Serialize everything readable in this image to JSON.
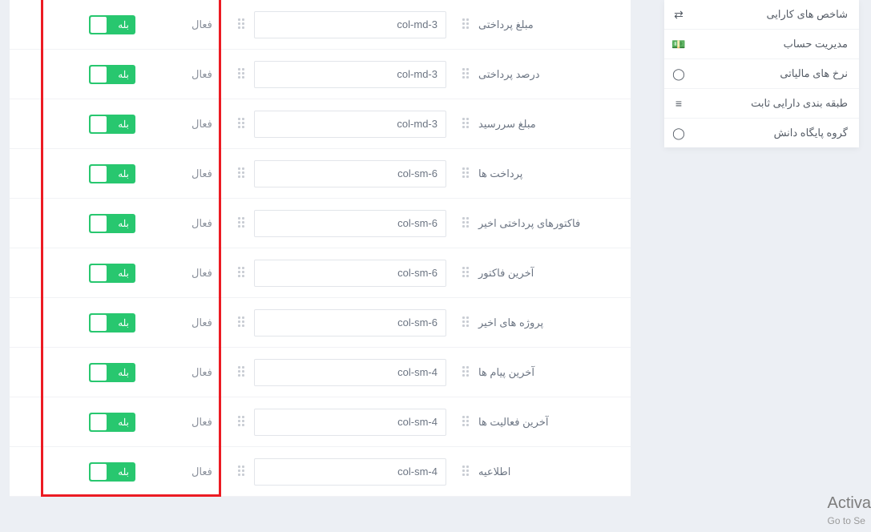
{
  "sidebar": {
    "items": [
      {
        "icon": "random-icon",
        "glyph": "⇄",
        "label": "شاخص های کارایی"
      },
      {
        "icon": "money-icon",
        "glyph": "💵",
        "label": "مدیریت حساب"
      },
      {
        "icon": "circle-icon",
        "glyph": "◯",
        "label": "نرخ های مالیاتی"
      },
      {
        "icon": "sliders-icon",
        "glyph": "≡",
        "label": "طبقه بندی دارایی ثابت"
      },
      {
        "icon": "circle-icon",
        "glyph": "◯",
        "label": "گروه پایگاه دانش"
      }
    ]
  },
  "toggle": {
    "on_label": "بله"
  },
  "rows": [
    {
      "name": "مبلغ پرداختی",
      "value": "col-md-3",
      "status": "فعال",
      "active": true
    },
    {
      "name": "درصد پرداختی",
      "value": "col-md-3",
      "status": "فعال",
      "active": true
    },
    {
      "name": "مبلغ سررسید",
      "value": "col-md-3",
      "status": "فعال",
      "active": true
    },
    {
      "name": "پرداخت ها",
      "value": "col-sm-6",
      "status": "فعال",
      "active": true
    },
    {
      "name": "فاکتورهای پرداختی اخیر",
      "value": "col-sm-6",
      "status": "فعال",
      "active": true
    },
    {
      "name": "آخرین فاکتور",
      "value": "col-sm-6",
      "status": "فعال",
      "active": true
    },
    {
      "name": "پروژه های اخیر",
      "value": "col-sm-6",
      "status": "فعال",
      "active": true
    },
    {
      "name": "آخرین پیام ها",
      "value": "col-sm-4",
      "status": "فعال",
      "active": true
    },
    {
      "name": "آخرین فعالیت ها",
      "value": "col-sm-4",
      "status": "فعال",
      "active": true
    },
    {
      "name": "اطلاعیه",
      "value": "col-sm-4",
      "status": "فعال",
      "active": true
    }
  ],
  "watermark": {
    "line1": "Activa",
    "line2": "Go to Se"
  }
}
